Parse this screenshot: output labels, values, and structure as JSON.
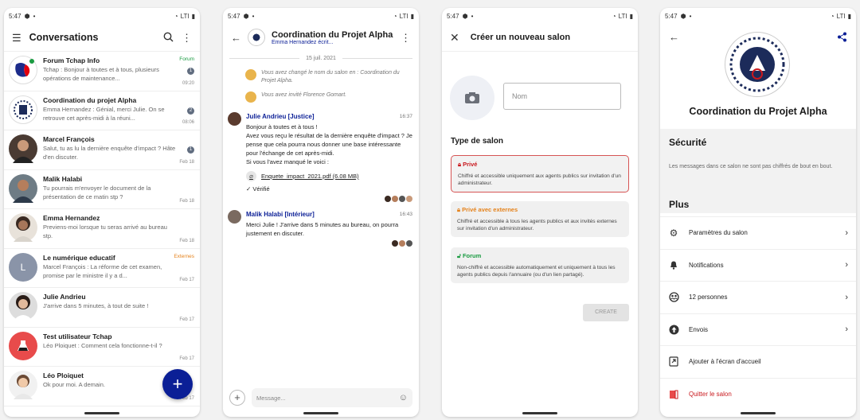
{
  "status": {
    "time": "5:47",
    "right": "LTI"
  },
  "list": {
    "title": "Conversations",
    "items": [
      {
        "name": "Forum Tchap Info",
        "preview": "Tchap : Bonjour à toutes et à tous, plusieurs opérations de maintenance...",
        "tag": "Forum",
        "date": "09:20",
        "badge": "1"
      },
      {
        "name": "Coordination du projet Alpha",
        "preview": "Emma Hernandez : Génial, merci Julie. On se retrouve cet après-midi à la réuni...",
        "tag": "",
        "date": "08:06",
        "badge": "2"
      },
      {
        "name": "Marcel François",
        "preview": "Salut, tu as lu la dernière enquête d'impact ? Hâte d'en discuter.",
        "tag": "",
        "date": "Feb 18",
        "badge": "1"
      },
      {
        "name": "Malik Halabi",
        "preview": "Tu pourrais m'envoyer le document de la présentation de ce matin stp ?",
        "tag": "",
        "date": "Feb 18",
        "badge": ""
      },
      {
        "name": "Emma Hernandez",
        "preview": "Previens-moi lorsque tu seras arrivé au bureau stp.",
        "tag": "",
        "date": "Feb 18",
        "badge": ""
      },
      {
        "name": "Le numérique educatif",
        "preview": "Marcel François : La réforme de cet examen, promise par le ministre il y a d...",
        "tag": "Externes",
        "date": "Feb 17",
        "badge": ""
      },
      {
        "name": "Julie Andrieu",
        "preview": "J'arrive dans 5 minutes, à tout de suite !",
        "tag": "",
        "date": "Feb 17",
        "badge": ""
      },
      {
        "name": "Test utilisateur Tchap",
        "preview": "Léo Ploiquet : Comment cela fonctionne-t-il ?",
        "tag": "",
        "date": "Feb 17",
        "badge": ""
      },
      {
        "name": "Léo Ploiquet",
        "preview": "Ok pour moi. A demain.",
        "tag": "",
        "date": "Feb 17",
        "badge": ""
      }
    ],
    "avatar_letter": "L",
    "fab": "+"
  },
  "chat": {
    "title": "Coordination du Projet Alpha",
    "subtitle": "Emma Hernandez écrit...",
    "date": "15 juil. 2021",
    "event1": "Vous avez changé le nom du salon en : Coordination du Projet Alpha.",
    "event2": "Vous avez invité Florence Gomart.",
    "msg1": {
      "sender": "Julie Andrieu [Justice]",
      "time": "16:37",
      "lines": [
        "Bonjour à toutes et à tous !",
        "Avez vous reçu le résultat de la dernière enquête d'impact ? Je pense que cela pourra nous donner une base intéressante pour l'échange de cet après-midi.",
        "Si vous l'avez manqué le voici :"
      ],
      "file": "Enquete_impact_2021.pdf (6.08 MB)",
      "check": "✓ Vérifié"
    },
    "msg2": {
      "sender": "Malik Halabi [Intérieur]",
      "time": "16:43",
      "text": "Merci Julie ! J'arrive dans 5 minutes au bureau, on pourra justement en discuter."
    },
    "placeholder": "Message..."
  },
  "create": {
    "title": "Créer un nouveau salon",
    "name_placeholder": "Nom",
    "type_label": "Type de salon",
    "options": [
      {
        "title": "Privé",
        "desc": "Chiffré et accessible uniquement aux agents publics sur invitation d'un administrateur.",
        "color": "#c9191e"
      },
      {
        "title": "Privé avec externes",
        "desc": "Chiffré et accessible à tous les agents publics et aux invités externes sur invitation d'un administrateur.",
        "color": "#e5821b"
      },
      {
        "title": "Forum",
        "desc": "Non-chiffré et accessible automatiquement et uniquement à tous les agents publics depuis l'annuaire (ou d'un lien partagé).",
        "color": "#1a9b41"
      }
    ],
    "button": "CREATE"
  },
  "settings": {
    "room": "Coordination du Projet Alpha",
    "security_title": "Sécurité",
    "security_desc": "Les messages dans ce salon ne sont pas chiffrés de bout en bout.",
    "plus_title": "Plus",
    "rows": [
      "Paramètres du salon",
      "Notifications",
      "12 personnes",
      "Envois",
      "Ajouter à l'écran d'accueil",
      "Quitter le salon"
    ]
  },
  "colors": {
    "brand": "#0b1f96",
    "danger": "#c9191e",
    "forum": "#1a9b41",
    "externes": "#e5821b"
  }
}
